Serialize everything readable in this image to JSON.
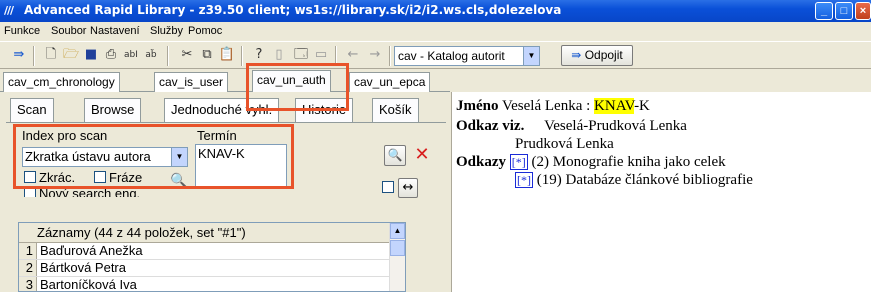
{
  "window": {
    "title": "Advanced Rapid Library - z39.50 client; ws1s://library.sk/i2/i2.ws.cls,dolezelova",
    "app_icon": "///"
  },
  "menu": [
    "Funkce",
    "Soubor",
    "Nastavení",
    "Služby",
    "Pomoc"
  ],
  "toolbar": {
    "catalog_select": "cav - Katalog autorit",
    "disconnect_label": "Odpojit",
    "icons": [
      "connect-icon",
      "new-icon",
      "open-icon",
      "save-icon",
      "print-icon",
      "abl-icon",
      "abc-icon",
      "cut-icon",
      "copy-icon",
      "paste-icon",
      "help-icon",
      "doc-icon",
      "preview-icon",
      "window-icon",
      "back-arrow-icon",
      "forward-arrow-icon"
    ]
  },
  "tabs": [
    "cav_cm_chronology",
    "cav_is_user",
    "cav_un_auth",
    "cav_un_epca"
  ],
  "active_tab": "cav_un_auth",
  "subtabs": [
    "Scan",
    "Browse",
    "Jednoduché vyhl.",
    "Historie",
    "Košík"
  ],
  "search": {
    "index_label": "Index pro scan",
    "index_value": "Zkratka ústavu autora",
    "term_label": "Termín",
    "term_value": "KNAV-K",
    "zkrac_label": "Zkrác.",
    "fraze_label": "Fráze",
    "novy_label": "Nový search eng."
  },
  "records": {
    "header": "Záznamy (44 z 44 položek, set \"#1\")",
    "rows": [
      {
        "n": "1",
        "name": "Baďurová Anežka"
      },
      {
        "n": "2",
        "name": "Bártková Petra"
      },
      {
        "n": "3",
        "name": "Bartoníčková Iva"
      }
    ]
  },
  "detail": {
    "jmeno_label": "Jméno",
    "jmeno_name": "Veselá Lenka :",
    "jmeno_code": "KNAV",
    "jmeno_suffix": "-K",
    "odkaz_label": "Odkaz viz.",
    "odkaz_value1": "Veselá-Prudková Lenka",
    "odkaz_value2": "Prudková Lenka",
    "odkazy_label": "Odkazy",
    "odkazy": [
      {
        "marker": "[*]",
        "text": "(2) Monografie kniha jako celek"
      },
      {
        "marker": "[*]",
        "text": "(19) Databáze článkové bibliografie"
      }
    ]
  }
}
